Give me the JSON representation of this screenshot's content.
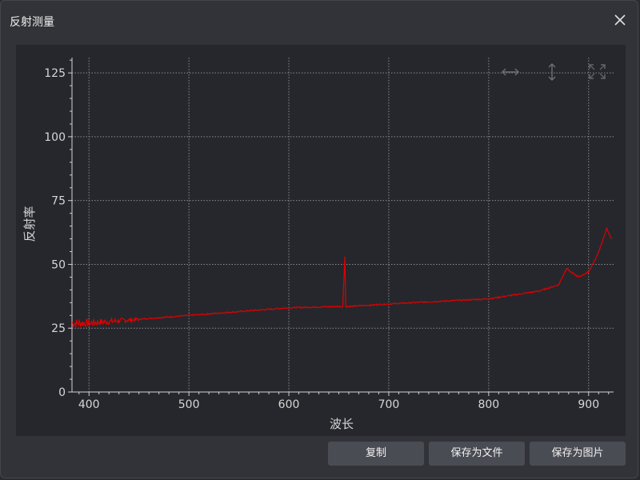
{
  "window": {
    "title": "反射测量",
    "close_icon": "close-icon"
  },
  "toolbar_icons": [
    "horizontal-zoom-icon",
    "vertical-zoom-icon",
    "fit-view-icon"
  ],
  "buttons": {
    "copy": "复制",
    "save_file": "保存为文件",
    "save_image": "保存为图片"
  },
  "colors": {
    "series": "#e00000",
    "background": "#26272c",
    "grid": "#8a8b90",
    "axis": "#d0d0d0"
  },
  "chart_data": {
    "type": "line",
    "xlabel": "波长",
    "ylabel": "反射率",
    "xlim": [
      383,
      925
    ],
    "ylim": [
      0,
      131
    ],
    "xticks": [
      400,
      500,
      600,
      700,
      800,
      900
    ],
    "yticks": [
      0,
      25,
      50,
      75,
      100,
      125
    ],
    "grid": true,
    "series": [
      {
        "color": "#e00000",
        "x": [
          383,
          400,
          450,
          500,
          550,
          600,
          650,
          654,
          656,
          657,
          658,
          660,
          700,
          750,
          800,
          850,
          870,
          878,
          882,
          890,
          900,
          908,
          913,
          918,
          923
        ],
        "y": [
          27,
          27,
          28.5,
          30,
          31.5,
          33,
          33.5,
          33.5,
          53,
          33.5,
          33.5,
          33.5,
          34.5,
          35.5,
          36.5,
          39.5,
          42,
          48.5,
          47,
          45,
          47,
          53,
          58,
          64,
          60
        ]
      }
    ]
  }
}
